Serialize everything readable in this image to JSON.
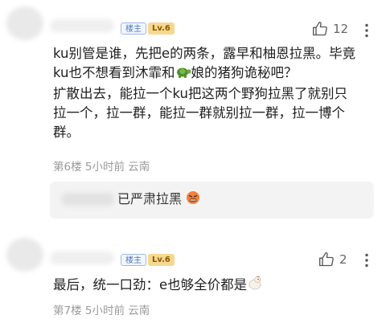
{
  "comment1": {
    "host_badge": "楼主",
    "level_badge": "Lv.6",
    "like_count": "12",
    "text_line1": "ku别管是谁，先把e的两条，露早和柚恩拉黑。毕竟",
    "text_line2_a": "ku也不想看到沐霏和",
    "text_line2_b": "娘的猪狗诡秘吧？",
    "text_line3": "扩散出去，能拉一个ku把这两个野狗拉黑了就别只",
    "text_line4": "拉一个，拉一群，能拉一群就别拉一群，拉一博个",
    "text_line5": "群。",
    "meta": "第6楼 5小时前 云南",
    "reply": {
      "text": "已严肃拉黑"
    }
  },
  "comment2": {
    "host_badge": "楼主",
    "level_badge": "Lv.6",
    "like_count": "2",
    "text": "最后，统一口劲：e也够全价都是",
    "meta": "第7楼 5小时前 云南"
  },
  "icons": {
    "like": "thumbs-up-icon",
    "more": "more-vertical-icon",
    "turtle": "turtle-emoji",
    "angry_face": "angry-face-emoji",
    "chicken": "chicken-emoji"
  }
}
